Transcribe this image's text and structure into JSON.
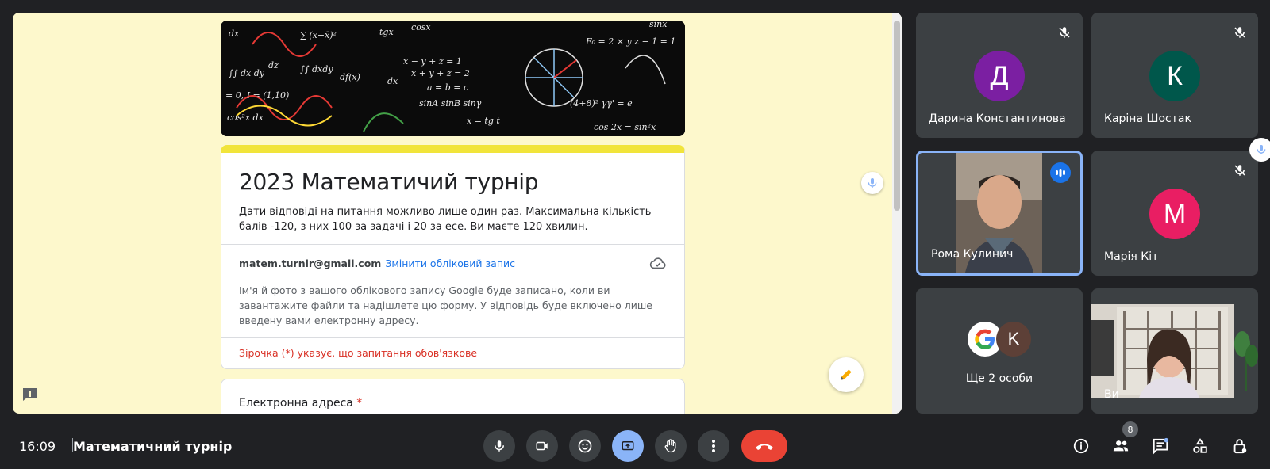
{
  "presentation": {
    "form": {
      "title": "2023 Математичий турнір",
      "description": "Дати відповіді на питання можливо лише один раз. Максимальна кількість балів -120, з них 100 за задачі і 20 за есе. Ви маєте 120 хвилин.",
      "account_email": "matem.turnir@gmail.com",
      "switch_account": "Змінити обліковий запис",
      "account_note": "Ім'я й фото з вашого облікового запису Google буде записано, коли ви завантажите файли та надішлете цю форму. У відповідь буде включено лише введену вами електронну адресу.",
      "required_note": "Зірочка (*) указує, що запитання обов'язкове",
      "question_label": "Електронна адреса",
      "required_star": "*",
      "header_color": "#f1e43a"
    }
  },
  "participants": [
    {
      "name": "Дарина Константинова",
      "initial": "Д",
      "color": "#7b1fa2",
      "muted": true
    },
    {
      "name": "Каріна Шостак",
      "initial": "К",
      "color": "#00574b",
      "muted": true
    },
    {
      "name": "Рома Кулинич",
      "speaking": true
    },
    {
      "name": "Марія Кіт",
      "initial": "М",
      "color": "#e91e63",
      "muted": true
    },
    {
      "name": "Ще 2 особи",
      "initial": "K"
    },
    {
      "name": "Ви"
    }
  ],
  "bottom_bar": {
    "time": "16:09",
    "meeting_name": "Математичний турнір",
    "people_count": "8",
    "controls": [
      "mic-icon",
      "camera-icon",
      "emoji-icon",
      "present-icon",
      "raise-hand-icon",
      "more-icon",
      "end-call-icon"
    ],
    "right_icons": [
      "info-icon",
      "people-icon",
      "chat-icon",
      "activities-icon",
      "host-controls-icon"
    ]
  }
}
